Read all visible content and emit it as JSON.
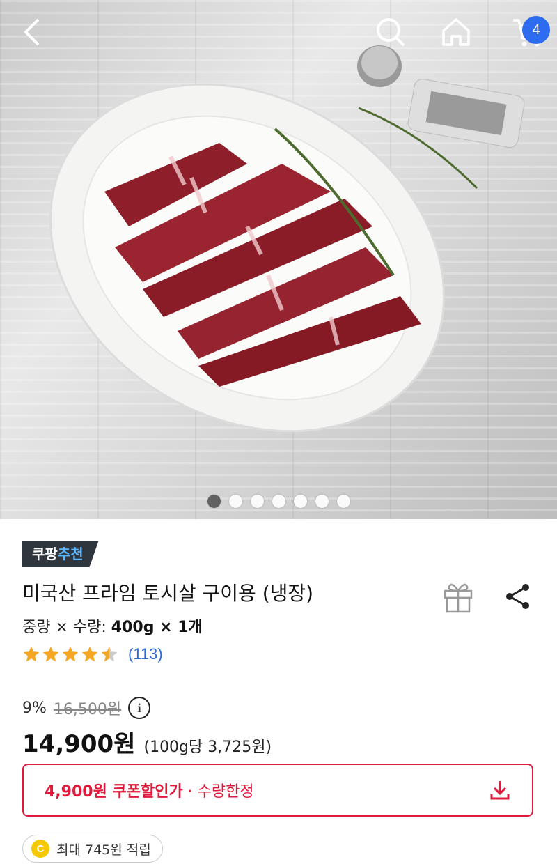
{
  "header": {
    "cart_count": "4"
  },
  "carousel": {
    "total": 7,
    "active": 1
  },
  "product": {
    "badge_prefix": "쿠팡",
    "badge_suffix": "추천",
    "title": "미국산 프라임 토시살 구이용 (냉장)",
    "option_label": "중량 × 수량: ",
    "option_value": "400g × 1개",
    "rating": 4.5,
    "review_count": "(113)",
    "discount_percent": "9%",
    "original_price": "16,500원",
    "price": "14,900원",
    "unit_price": "(100g당 3,725원)",
    "coupon_amount": "4,900원 쿠폰할인가",
    "coupon_note": " · 수량한정",
    "points_text": "최대 745원 적립",
    "coin_symbol": "C"
  },
  "colors": {
    "accent_red": "#e0193b",
    "badge_blue": "#2d6bf0",
    "star": "#f5a623",
    "review_link": "#2e6bd6"
  },
  "icons": [
    "back-icon",
    "search-icon",
    "home-icon",
    "cart-icon",
    "gift-icon",
    "share-icon",
    "info-icon",
    "download-icon",
    "coin-icon"
  ]
}
